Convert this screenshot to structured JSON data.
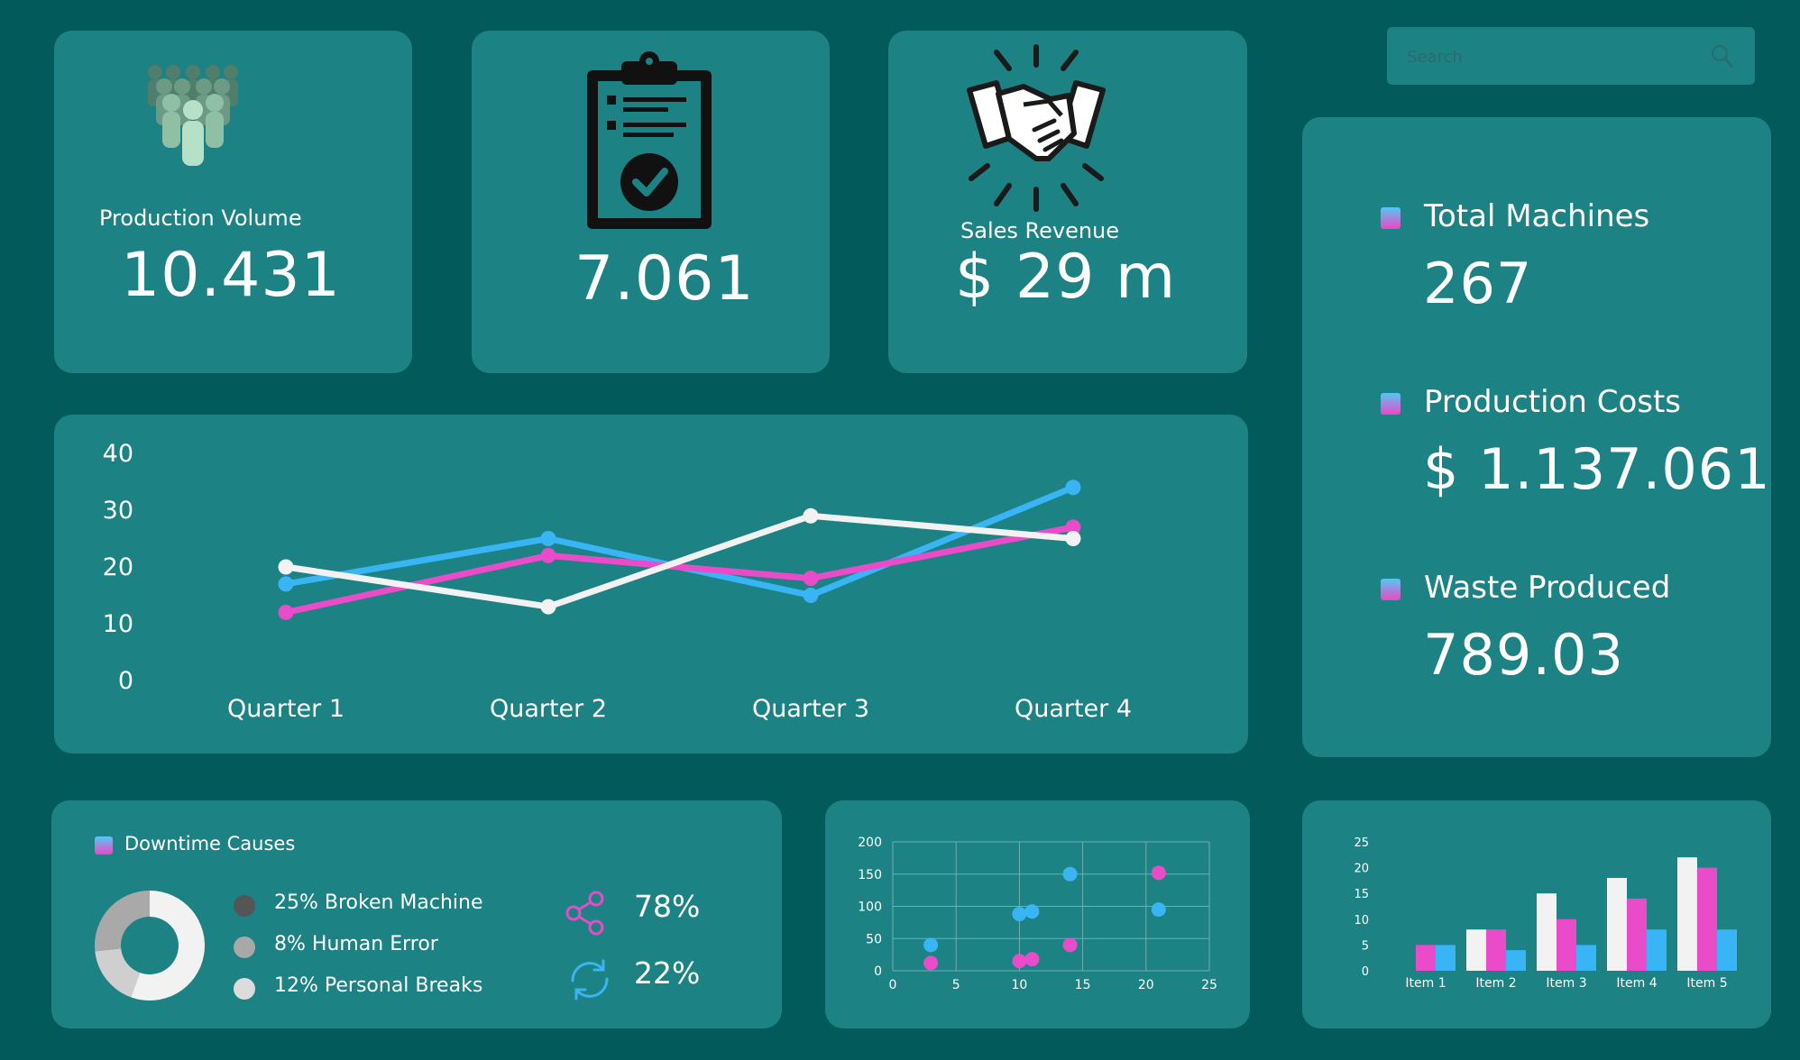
{
  "search": {
    "placeholder": "Search"
  },
  "kpis": {
    "production_volume": {
      "label": "Production Volume",
      "value": "10.431"
    },
    "quality": {
      "value": "7.061"
    },
    "sales_revenue": {
      "label": "Sales Revenue",
      "value": "$ 29 m"
    }
  },
  "side_metrics": [
    {
      "label": "Total Machines",
      "value": "267"
    },
    {
      "label": "Production Costs",
      "value": "$ 1.137.061"
    },
    {
      "label": "Waste Produced",
      "value": "789.03"
    }
  ],
  "downtime": {
    "title": "Downtime Causes",
    "legend": [
      {
        "label": "25% Broken Machine",
        "color": "#555555"
      },
      {
        "label": "8% Human Error",
        "color": "#a8a8a8"
      },
      {
        "label": "12% Personal Breaks",
        "color": "#dcdcdc"
      }
    ],
    "stats": [
      {
        "icon": "share-icon",
        "value": "78%",
        "color": "#e54cc6"
      },
      {
        "icon": "refresh-icon",
        "value": "22%",
        "color": "#3ab4f2"
      }
    ]
  },
  "colors": {
    "pink": "#e94bc9",
    "blue": "#39b5f5",
    "white": "#f2f2f2"
  },
  "chart_data": [
    {
      "type": "line",
      "categories": [
        "Quarter 1",
        "Quarter 2",
        "Quarter 3",
        "Quarter 4"
      ],
      "series": [
        {
          "values": [
            17,
            25,
            15,
            34
          ],
          "color": "#39b5f5"
        },
        {
          "values": [
            12,
            22,
            18,
            27
          ],
          "color": "#e94bc9"
        },
        {
          "values": [
            20,
            13,
            29,
            25
          ],
          "color": "#f2f2f2"
        }
      ],
      "yticks": [
        "0",
        "10",
        "20",
        "30",
        "40"
      ],
      "ylim": [
        0,
        40
      ]
    },
    {
      "type": "pie",
      "values": [
        25,
        8,
        12
      ],
      "colors": [
        "#f2f2f2",
        "#cfcfcf",
        "#a9a9a9"
      ]
    },
    {
      "type": "scatter",
      "series": [
        {
          "color": "#39b5f5",
          "points": [
            [
              3,
              40
            ],
            [
              10,
              88
            ],
            [
              11,
              92
            ],
            [
              14,
              150
            ],
            [
              21,
              95
            ]
          ]
        },
        {
          "color": "#e94bc9",
          "points": [
            [
              3,
              12
            ],
            [
              10,
              15
            ],
            [
              11,
              18
            ],
            [
              14,
              40
            ],
            [
              21,
              152
            ]
          ]
        }
      ],
      "xticks": [
        "0",
        "5",
        "10",
        "15",
        "20",
        "25"
      ],
      "yticks": [
        "0",
        "50",
        "100",
        "150",
        "200"
      ],
      "xlim": [
        0,
        25
      ],
      "ylim": [
        0,
        200
      ],
      "grid": true
    },
    {
      "type": "bar",
      "categories": [
        "Item 1",
        "Item 2",
        "Item 3",
        "Item 4",
        "Item 5"
      ],
      "series": [
        {
          "values": [
            0,
            8,
            15,
            18,
            22
          ],
          "color": "#f2f2f2"
        },
        {
          "values": [
            5,
            8,
            10,
            14,
            20
          ],
          "color": "#e94bc9"
        },
        {
          "values": [
            5,
            4,
            5,
            8,
            8
          ],
          "color": "#39b5f5"
        }
      ],
      "yticks": [
        "0",
        "5",
        "10",
        "15",
        "20",
        "25"
      ],
      "ylim": [
        0,
        25
      ]
    }
  ]
}
